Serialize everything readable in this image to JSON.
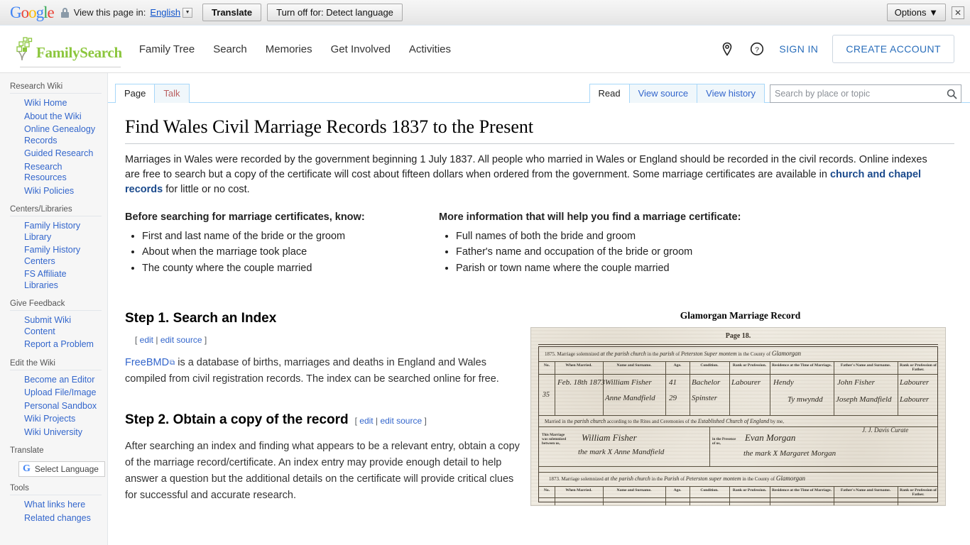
{
  "translate_bar": {
    "brand": "Google",
    "lock_icon": "lock-icon",
    "view_label": "View this page in:",
    "language_value": "English",
    "translate_button": "Translate",
    "turn_off_button": "Turn off for: Detect language",
    "options_button": "Options",
    "close_icon": "close-icon"
  },
  "header": {
    "logo_text": "FamilySearch",
    "nav": [
      {
        "label": "Family Tree"
      },
      {
        "label": "Search"
      },
      {
        "label": "Memories"
      },
      {
        "label": "Get Involved"
      },
      {
        "label": "Activities"
      }
    ],
    "location_icon": "map-pin-icon",
    "help_icon": "question-circle-icon",
    "sign_in": "SIGN IN",
    "create_account": "CREATE ACCOUNT"
  },
  "sidebar": {
    "groups": [
      {
        "title": "Research Wiki",
        "items": [
          {
            "label": "Wiki Home"
          },
          {
            "label": "About the Wiki"
          },
          {
            "label": "Online Genealogy Records"
          },
          {
            "label": "Guided Research"
          },
          {
            "label": "Research Resources"
          },
          {
            "label": "Wiki Policies"
          }
        ]
      },
      {
        "title": "Centers/Libraries",
        "items": [
          {
            "label": "Family History Library"
          },
          {
            "label": "Family History Centers"
          },
          {
            "label": "FS Affiliate Libraries"
          }
        ]
      },
      {
        "title": "Give Feedback",
        "items": [
          {
            "label": "Submit Wiki Content"
          },
          {
            "label": "Report a Problem"
          }
        ]
      },
      {
        "title": "Edit the Wiki",
        "items": [
          {
            "label": "Become an Editor"
          },
          {
            "label": "Upload File/Image"
          },
          {
            "label": "Personal Sandbox"
          },
          {
            "label": "Wiki Projects"
          },
          {
            "label": "Wiki University"
          }
        ]
      }
    ],
    "translate_title": "Translate",
    "select_language": "Select Language",
    "tools_title": "Tools",
    "tools_items": [
      {
        "label": "What links here"
      },
      {
        "label": "Related changes"
      }
    ]
  },
  "tabs": {
    "left": [
      {
        "label": "Page",
        "active": true
      },
      {
        "label": "Talk",
        "active": false
      }
    ],
    "right": [
      {
        "label": "Read",
        "active": true
      },
      {
        "label": "View source",
        "active": false
      },
      {
        "label": "View history",
        "active": false
      }
    ]
  },
  "search": {
    "placeholder": "Search by place or topic",
    "value": "",
    "icon": "search-icon"
  },
  "main": {
    "title": "Find Wales Civil Marriage Records 1837 to the Present",
    "intro_part1": "Marriages in Wales were recorded by the government beginning 1 July 1837. All people who married in Wales or England should be recorded in the civil records. Online indexes are free to search but a copy of the certificate will cost about fifteen dollars when ordered from the government. Some marriage certificates are available in ",
    "intro_link": "church and chapel records",
    "intro_part2": " for little or no cost.",
    "columns": [
      {
        "heading": "Before searching for marriage certificates, know:",
        "items": [
          "First and last name of the bride or the groom",
          "About when the marriage took place",
          "The county where the couple married"
        ]
      },
      {
        "heading": "More information that will help you find a marriage certificate:",
        "items": [
          "Full names of both the bride and groom",
          "Father's name and occupation of the bride or groom",
          "Parish or town name where the couple married"
        ]
      }
    ],
    "step1": {
      "heading": "Step 1.  Search an Index",
      "edit_open": "[ ",
      "edit": "edit",
      "edit_sep": " | ",
      "edit_source": "edit source",
      "edit_close": " ]",
      "link_text": "FreeBMD",
      "body": " is a database of births, marriages and deaths in England and Wales compiled from civil registration records. The index can be searched online for free."
    },
    "step2": {
      "heading": "Step 2.  Obtain a copy of the record",
      "edit_open": "[ ",
      "edit": "edit",
      "edit_sep": " | ",
      "edit_source": "edit source",
      "edit_close": " ]",
      "body": "After searching an index and finding what appears to be a relevant entry, obtain a copy of the marriage record/certificate. An index entry may provide enough detail to help answer a question but the additional details on the certificate will provide critical clues for successful and accurate research."
    },
    "figure": {
      "caption": "Glamorgan Marriage Record",
      "page_label": "Page 18.",
      "row1_year": "1875.",
      "solemnized_text": "Marriage solemnized",
      "in_the": "in the",
      "of": "of",
      "in_the_county": "in the County",
      "of2": "of",
      "parish_hand": "at the parish church",
      "parish2_hand": "parish",
      "district_hand": "Peterston Super montem",
      "county_hand": "Glamorgan",
      "columns": [
        "No.",
        "When Married.",
        "Name and Surname.",
        "Age.",
        "Condition.",
        "Rank or Profession.",
        "Residence at the Time of Marriage.",
        "Father's Name and Surname.",
        "Rank or Profession of Father."
      ],
      "entry_no": "35",
      "entry": {
        "date": "Feb. 18th 1873",
        "groom": "William Fisher",
        "bride": "Anne Mandfield",
        "groom_age": "41",
        "bride_age": "29",
        "groom_condition": "Bachelor",
        "bride_condition": "Spinster",
        "rank": "Labourer",
        "residence1": "Hendy",
        "residence2": "Ty mwyndd",
        "father1": "John Fisher",
        "father2": "Joseph Mandfield",
        "father_rank1": "Labourer",
        "father_rank2": "Labourer"
      },
      "married_in_the": "Married in the",
      "married_hand": "parish church",
      "rites_text": "according to the Rites and Ceremonies of the",
      "rites_hand": "Established Church of England",
      "by_me": "by me,",
      "officiant": "J. J. Davis Curate",
      "this_marriage": "This Marriage was solemnized between us,",
      "in_presence": "in the Presence of us,",
      "sig_groom": "William Fisher",
      "sig_bride": "the mark X Anne Mandfield",
      "witness1": "Evan Morgan",
      "witness2": "the mark X Margaret Morgan",
      "row2_year": "1873.",
      "row2_parish": "Parish",
      "row2_district": "Peterston super montem",
      "row2_county": "Glamorgan"
    }
  }
}
